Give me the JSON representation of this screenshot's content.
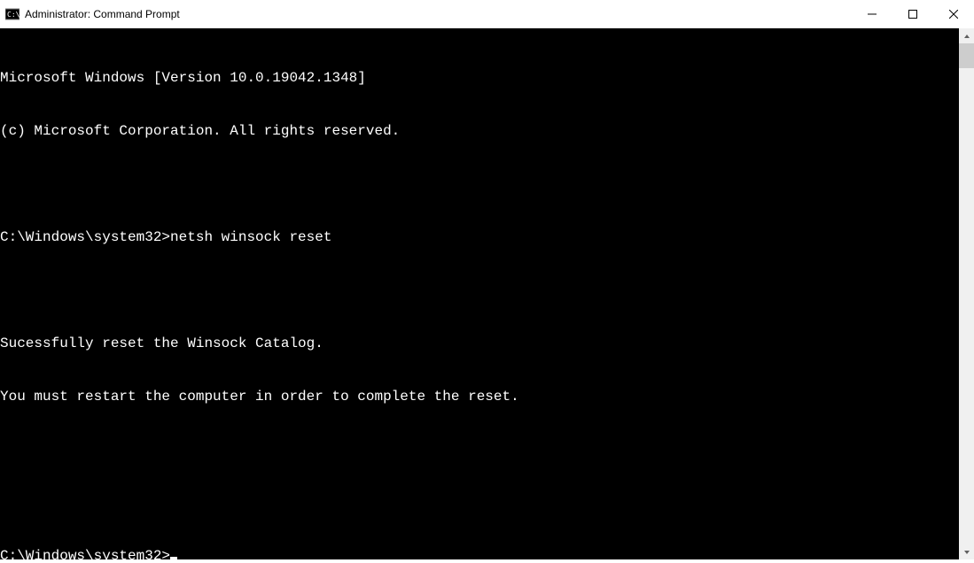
{
  "window": {
    "title": "Administrator: Command Prompt"
  },
  "terminal": {
    "line_version": "Microsoft Windows [Version 10.0.19042.1348]",
    "line_copyright": "(c) Microsoft Corporation. All rights reserved.",
    "prompt1": "C:\\Windows\\system32>",
    "command1": "netsh winsock reset",
    "output_line1": "Sucessfully reset the Winsock Catalog.",
    "output_line2": "You must restart the computer in order to complete the reset.",
    "prompt2": "C:\\Windows\\system32>"
  }
}
